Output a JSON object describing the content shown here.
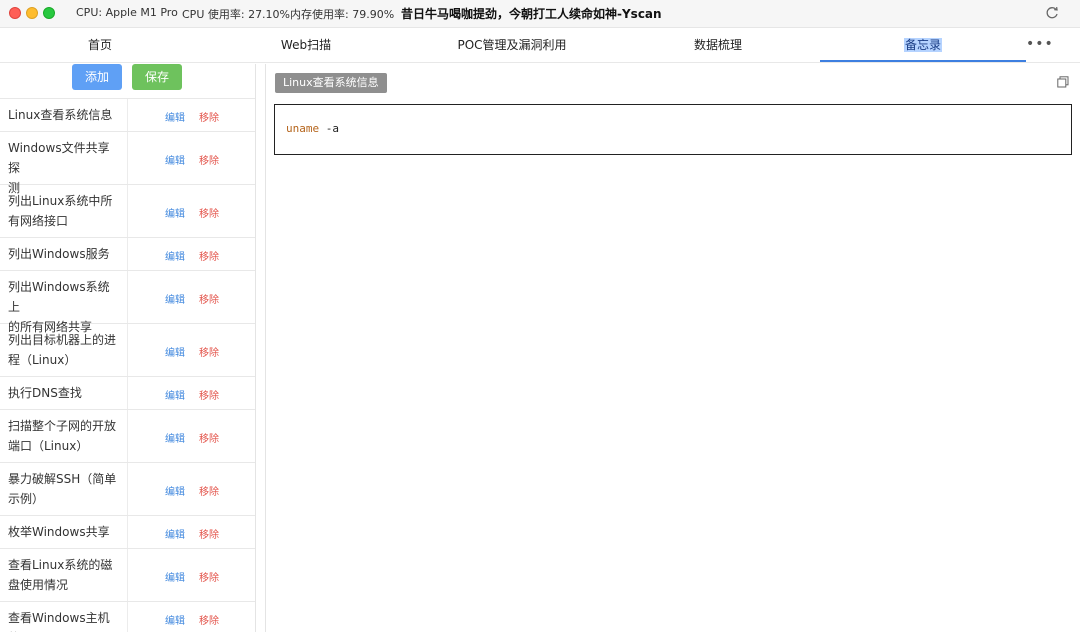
{
  "titlebar": {
    "cpu_model": "CPU: Apple M1 Pro",
    "cpu_usage": "CPU 使用率: 27.10%",
    "mem_usage": "内存使用率: 79.90%",
    "title": "昔日牛马喝咖提劲，今朝打工人续命如神-Yscan",
    "refresh_icon": "refresh-icon"
  },
  "tabs": [
    {
      "label": "首页"
    },
    {
      "label": "Web扫描"
    },
    {
      "label": "POC管理及漏洞利用"
    },
    {
      "label": "数据梳理"
    },
    {
      "label": "备忘录"
    }
  ],
  "tabs_more": "•••",
  "toolbar": {
    "add_label": "添加",
    "save_label": "保存"
  },
  "row_actions": {
    "edit": "编辑",
    "remove": "移除"
  },
  "notes": [
    {
      "l1": "Linux查看系统信息",
      "l2": ""
    },
    {
      "l1": "Windows文件共享探",
      "l2": "测"
    },
    {
      "l1": "列出Linux系统中所",
      "l2": "有网络接口"
    },
    {
      "l1": "列出Windows服务",
      "l2": ""
    },
    {
      "l1": "列出Windows系统上",
      "l2": "的所有网络共享"
    },
    {
      "l1": "列出目标机器上的进",
      "l2": "程（Linux）"
    },
    {
      "l1": "执行DNS查找",
      "l2": ""
    },
    {
      "l1": "扫描整个子网的开放",
      "l2": "端口（Linux）"
    },
    {
      "l1": "暴力破解SSH（简单",
      "l2": "示例）"
    },
    {
      "l1": "枚举Windows共享",
      "l2": ""
    },
    {
      "l1": "查看Linux系统的磁",
      "l2": "盘使用情况"
    },
    {
      "l1": "查看Windows主机的",
      "l2": ""
    }
  ],
  "editor": {
    "note_title": "Linux查看系统信息",
    "code_cmd": "uname",
    "code_arg": " -a",
    "copy_icon": "copy-icon"
  },
  "colors": {
    "accent": "#3d7fe0",
    "add_button": "#5fa0f5",
    "save_button": "#6ec25d",
    "edit_link": "#3f87de",
    "remove_link": "#e3534a"
  }
}
